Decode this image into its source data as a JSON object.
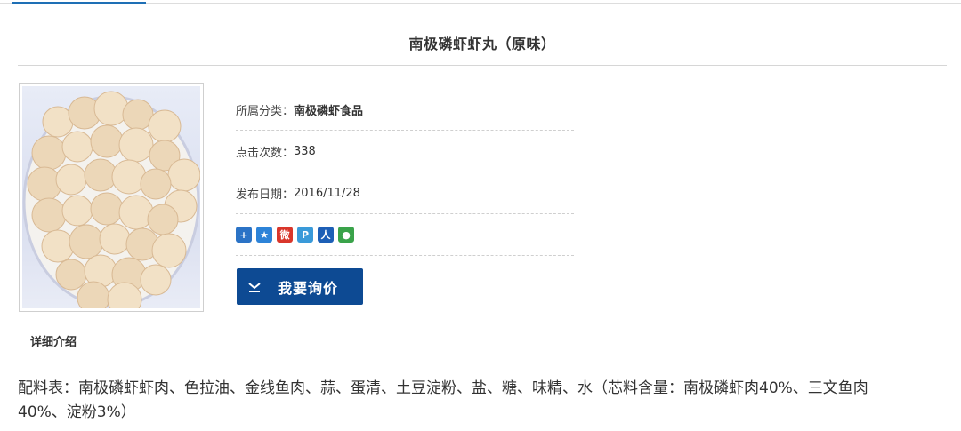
{
  "product": {
    "title": "南极磷虾虾丸（原味）",
    "image_alt": "南极磷虾虾丸"
  },
  "info": {
    "category_label": "所属分类：",
    "category_value": "南极磷虾食品",
    "clicks_label": "点击次数：",
    "clicks_value": "338",
    "date_label": "发布日期：",
    "date_value": "2016/11/28"
  },
  "share": {
    "icons": [
      {
        "name": "share-more-icon",
        "glyph": "+",
        "color": "#2b73c6"
      },
      {
        "name": "qzone-icon",
        "glyph": "★",
        "color": "#2d83d8"
      },
      {
        "name": "weibo-icon",
        "glyph": "微",
        "color": "#d9362b"
      },
      {
        "name": "tencent-weibo-icon",
        "glyph": "P",
        "color": "#3a9ad9"
      },
      {
        "name": "renren-icon",
        "glyph": "人",
        "color": "#1d5fb6"
      },
      {
        "name": "wechat-icon",
        "glyph": "●",
        "color": "#3aa34a"
      }
    ]
  },
  "actions": {
    "inquiry_label": "我要询价"
  },
  "detail": {
    "tab_label": "详细介绍",
    "ingredients_text": "配料表：南极磷虾虾肉、色拉油、金线鱼肉、蒜、蛋清、土豆淀粉、盐、糖、味精、水（芯料含量：南极磷虾肉40%、三文鱼肉40%、淀粉3%）"
  },
  "colors": {
    "accent": "#1e6fb5",
    "button": "#0d4a93"
  }
}
